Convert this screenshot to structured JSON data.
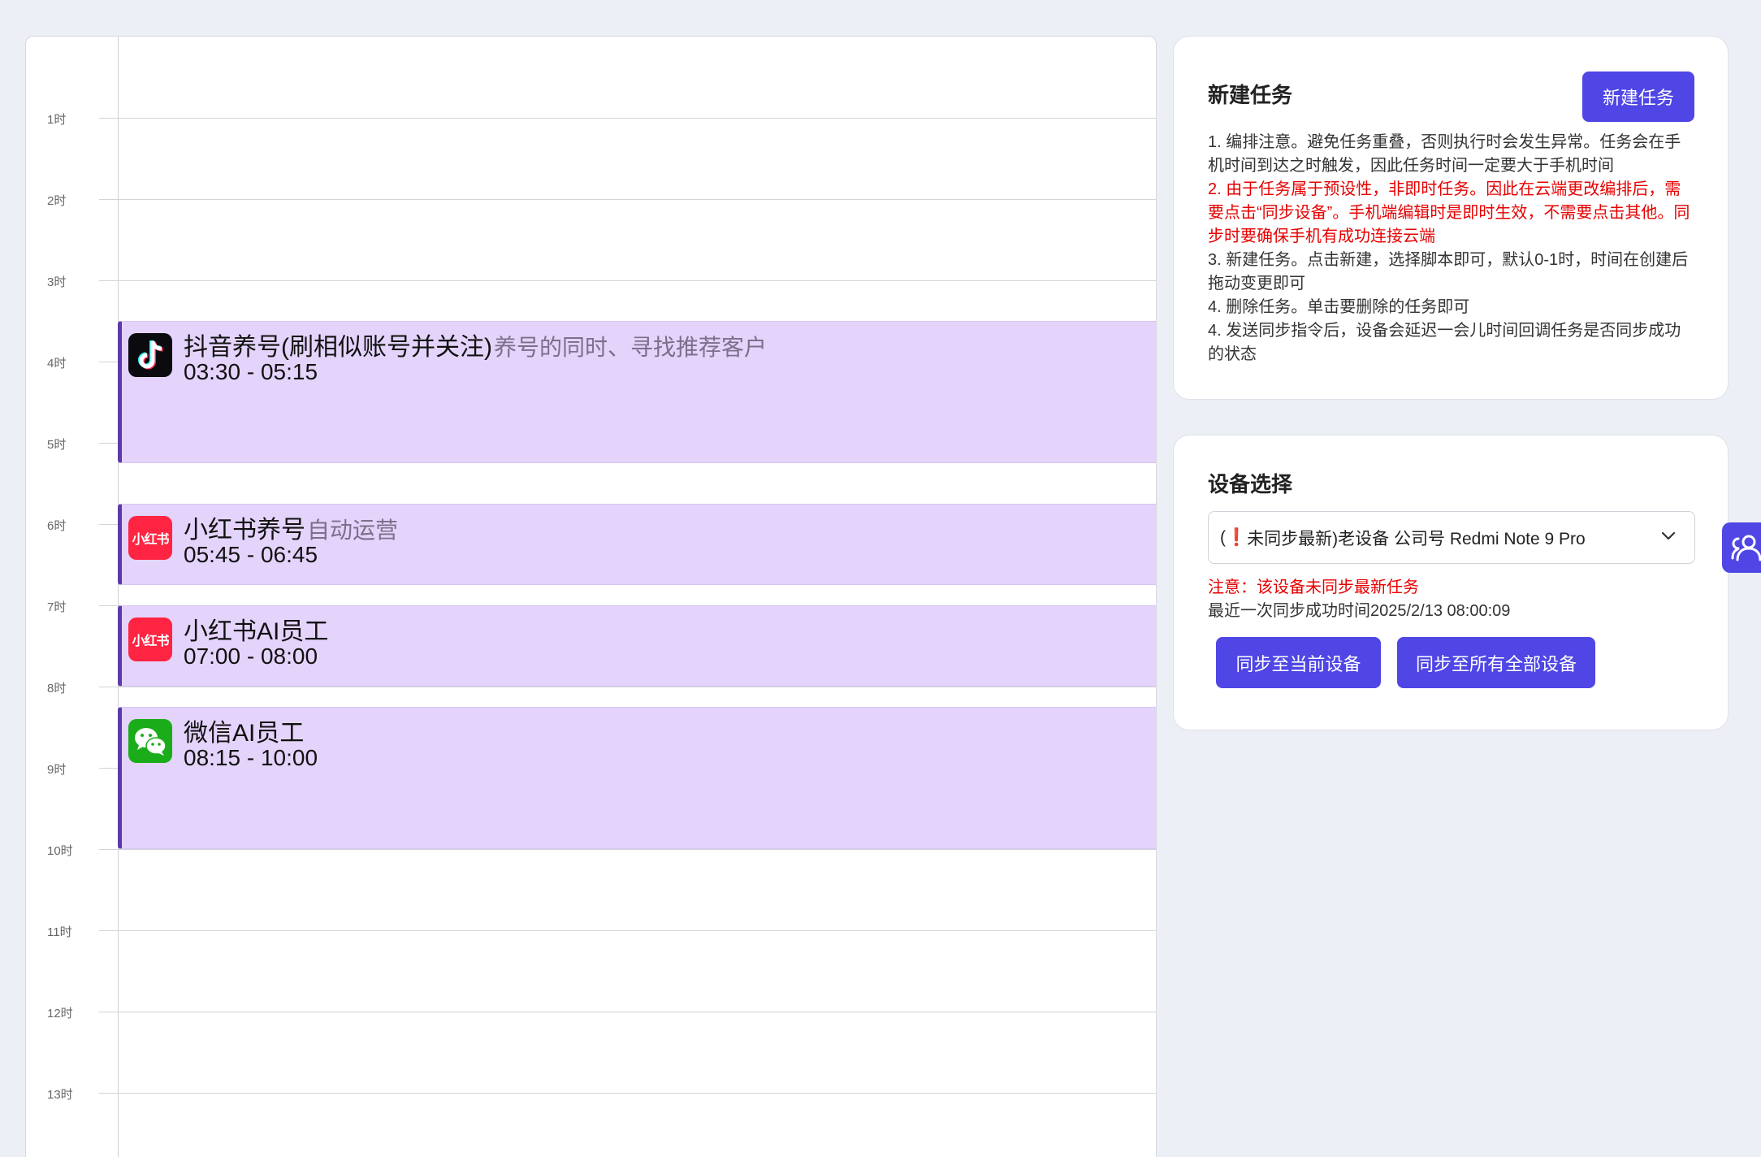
{
  "calendar": {
    "hours": [
      "1时",
      "2时",
      "3时",
      "4时",
      "5时",
      "6时",
      "7时",
      "8时",
      "9时",
      "10时",
      "11时",
      "12时",
      "13时"
    ],
    "events": [
      {
        "icon": "douyin-icon",
        "title": "抖音养号(刷相似账号并关注)",
        "time": "03:30 - 05:15",
        "desc": "养号的同时、寻找推荐客户"
      },
      {
        "icon": "xiaohongshu-icon",
        "icon_text": "小红书",
        "title": "小红书养号",
        "time": "05:45 - 06:45",
        "desc": "自动运营"
      },
      {
        "icon": "xiaohongshu-icon",
        "icon_text": "小红书",
        "title": "小红书AI员工",
        "time": "07:00 - 08:00",
        "desc": ""
      },
      {
        "icon": "wechat-icon",
        "title": "微信AI员工",
        "time": "08:15 - 10:00",
        "desc": ""
      }
    ]
  },
  "new_task": {
    "title": "新建任务",
    "button": "新建任务",
    "notes": [
      {
        "text": "1. 编排注意。避免任务重叠，否则执行时会发生异常。任务会在手机时间到达之时触发，因此任务时间一定要大于手机时间",
        "red": false
      },
      {
        "text": "2. 由于任务属于预设性，非即时任务。因此在云端更改编排后，需要点击“同步设备”。手机端编辑时是即时生效，不需要点击其他。同步时要确保手机有成功连接云端",
        "red": true
      },
      {
        "text": "3. 新建任务。点击新建，选择脚本即可，默认0-1时，时间在创建后拖动变更即可",
        "red": false
      },
      {
        "text": "4. 删除任务。单击要删除的任务即可",
        "red": false
      },
      {
        "text": "4. 发送同步指令后，设备会延迟一会儿时间回调任务是否同步成功的状态",
        "red": false
      }
    ]
  },
  "device": {
    "title": "设备选择",
    "select_prefix": "(",
    "select_mark": "❗",
    "select_value": "未同步最新)老设备 公司号 Redmi Note 9 Pro",
    "warning": "注意：该设备未同步最新任务",
    "last_sync": "最近一次同步成功时间2025/2/13 08:00:09",
    "sync_current": "同步至当前设备",
    "sync_all": "同步至所有全部设备"
  },
  "colors": {
    "accent": "#4f46e5",
    "event_bg": "#e4d4fb",
    "event_border": "#5c3aa8",
    "warning": "#e60000"
  }
}
